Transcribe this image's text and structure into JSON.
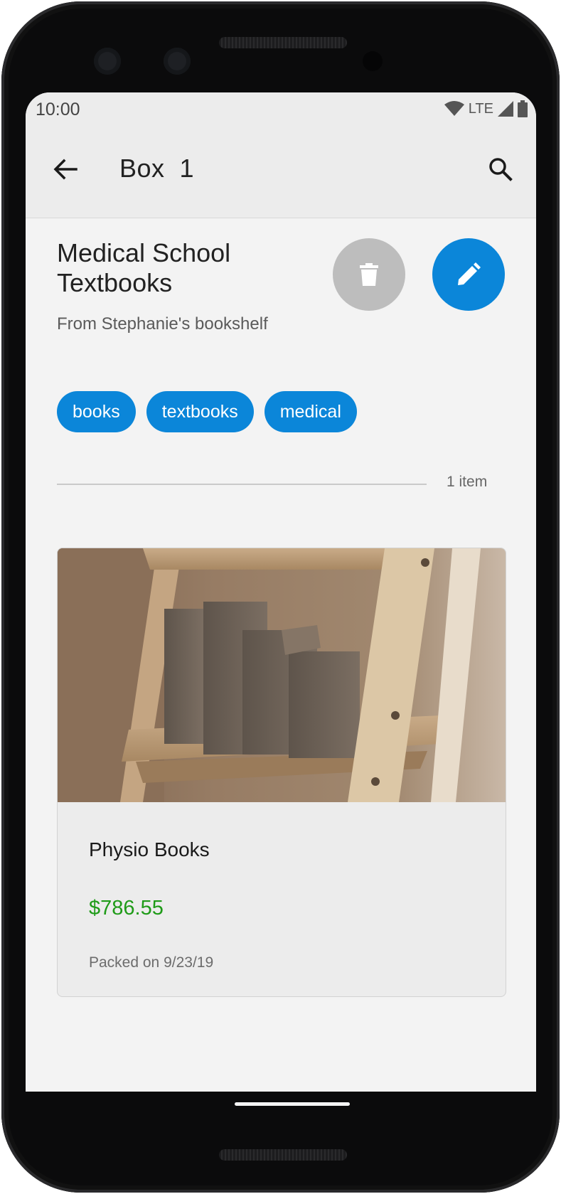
{
  "status_bar": {
    "time": "10:00",
    "network": "LTE"
  },
  "app_bar": {
    "title": "Box  1"
  },
  "box": {
    "name": "Medical School Textbooks",
    "description": "From Stephanie's bookshelf",
    "tags": [
      "books",
      "textbooks",
      "medical"
    ],
    "item_count": "1 item"
  },
  "items": [
    {
      "name": "Physio Books",
      "price": "$786.55",
      "packed": "Packed on 9/23/19"
    }
  ],
  "colors": {
    "accent": "#0b86d9",
    "price": "#1f9b18",
    "delete": "#bdbdbd"
  },
  "icons": [
    "back-arrow-icon",
    "search-icon",
    "trash-icon",
    "pencil-icon",
    "wifi-icon",
    "signal-icon",
    "battery-icon"
  ]
}
